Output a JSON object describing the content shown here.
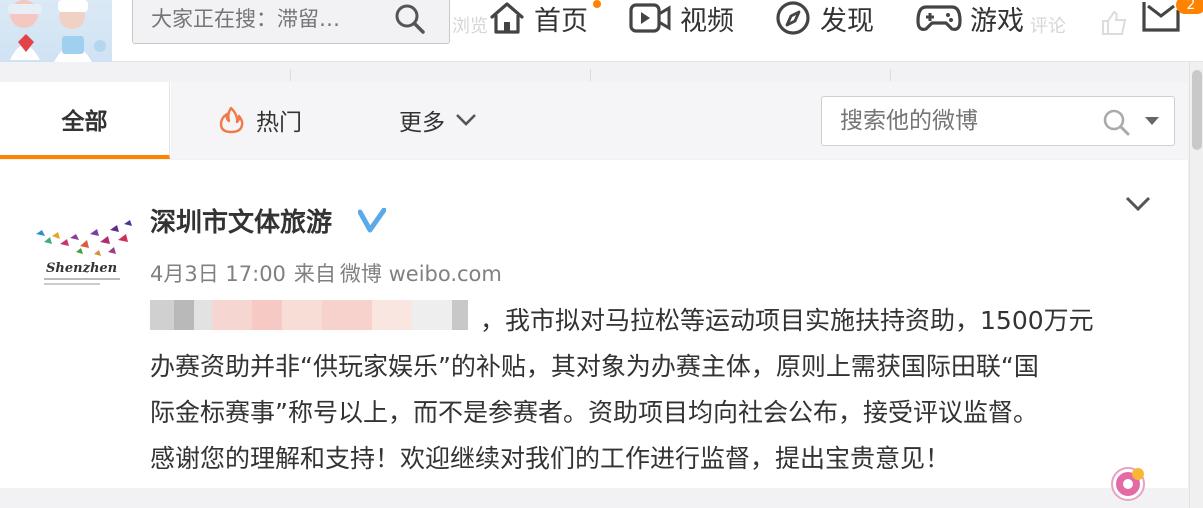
{
  "topnav": {
    "search_placeholder": "大家正在搜：滞留…",
    "faded_hint_1": "浏览",
    "faded_hint_2": "评论",
    "items": [
      {
        "label": "首页",
        "icon": "home-icon"
      },
      {
        "label": "视频",
        "icon": "video-icon"
      },
      {
        "label": "发现",
        "icon": "compass-icon"
      },
      {
        "label": "游戏",
        "icon": "gamepad-icon"
      }
    ],
    "message_badge": "2",
    "accent_color": "#ff8200"
  },
  "tabs": {
    "all": "全部",
    "hot": "热门",
    "more": "更多",
    "search_placeholder": "搜索他的微博"
  },
  "post": {
    "author": "深圳市文体旅游",
    "avatar_text": "Shenzhen",
    "date": "4月3日 17:00",
    "via": "来自",
    "source": "微博 weibo.com",
    "lines": [
      "，我市拟对马拉松等运动项目实施扶持资助，1500万元",
      "办赛资助并非“供玩家娱乐”的补贴，其对象为办赛主体，原则上需获国际田联“国",
      "际金标赛事”称号以上，而不是参赛者。资助项目均向社会公布，接受评议监督。",
      "感谢您的理解和支持！欢迎继续对我们的工作进行监督，提出宝贵意见！"
    ],
    "verified_color": "#5aaae7"
  }
}
